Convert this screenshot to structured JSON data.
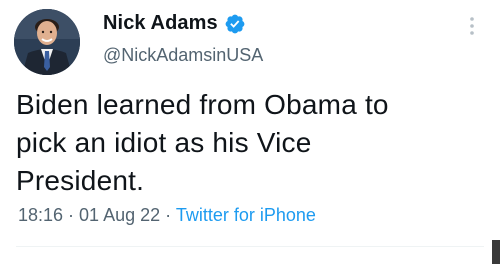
{
  "author": {
    "display_name": "Nick Adams",
    "handle": "@NickAdamsinUSA",
    "verified_icon": "verified-badge-icon",
    "avatar_icon": "profile-photo"
  },
  "tweet": {
    "text": "Biden learned from Obama to\npick an idiot as his Vice\nPresident."
  },
  "meta": {
    "time": "18:16",
    "separator1": " · ",
    "date": "01 Aug 22",
    "separator2": " · ",
    "source": "Twitter for iPhone"
  },
  "colors": {
    "text": "#0f1419",
    "secondary": "#536471",
    "accent": "#1d9bf0"
  }
}
